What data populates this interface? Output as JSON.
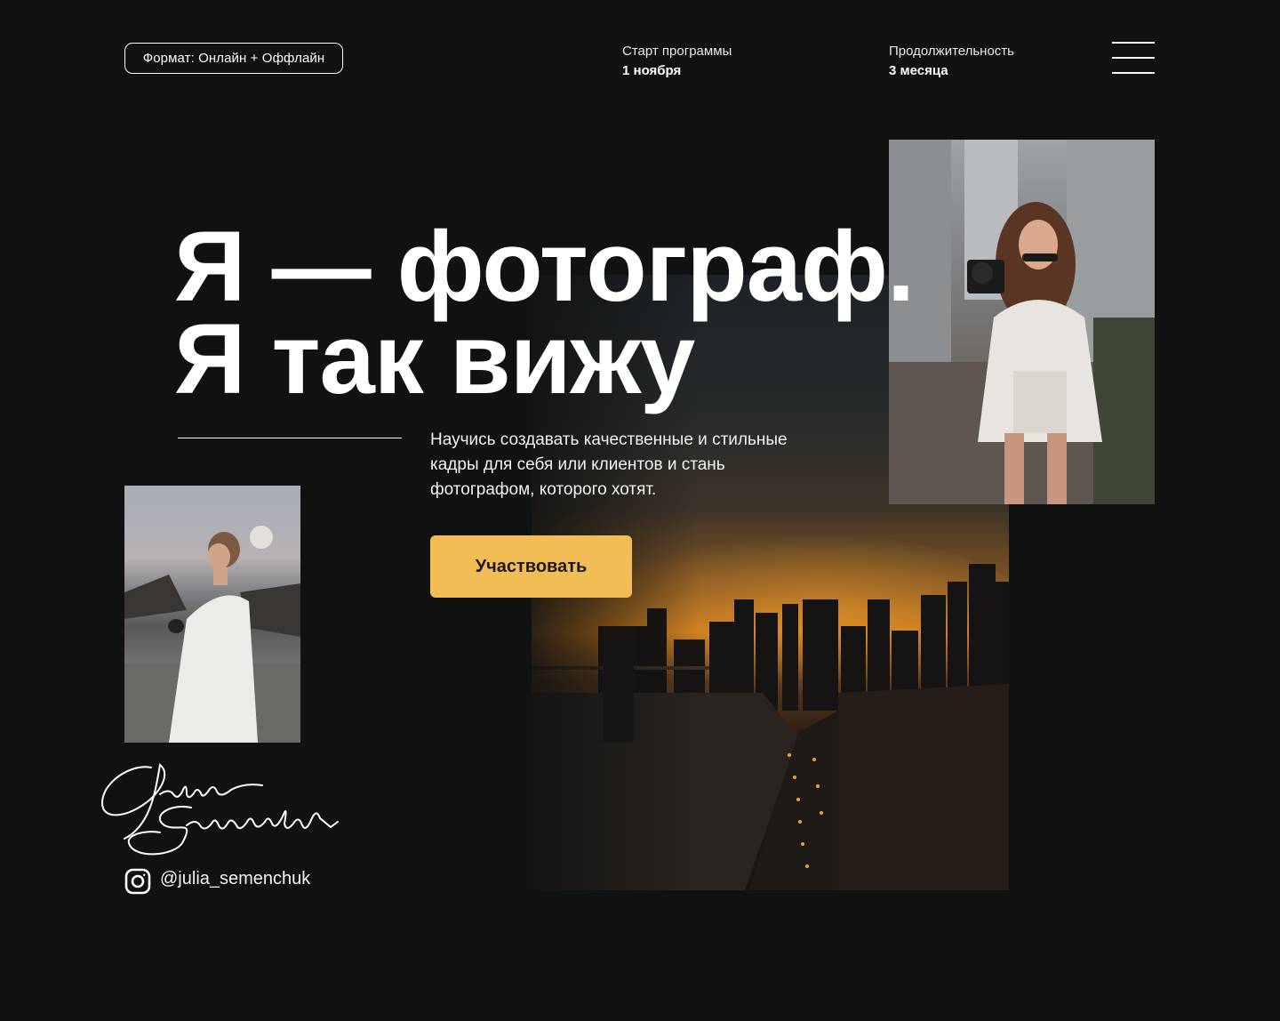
{
  "header": {
    "format_label": "Формат: Онлайн + Оффлайн",
    "start": {
      "label": "Старт программы",
      "value": "1 ноября"
    },
    "duration": {
      "label": "Продолжительность",
      "value": "3 месяца"
    }
  },
  "hero": {
    "title_line1": "Я — фотограф.",
    "title_line2": "Я так вижу",
    "description": "Научись создавать качественные и стильные кадры для себя или клиентов и стань фотографом, которого хотят.",
    "cta_label": "Участвовать"
  },
  "signature_text": "Julia Semenchuk",
  "social": {
    "icon": "instagram-icon",
    "handle": "@julia_semenchuk"
  },
  "colors": {
    "background": "#101111",
    "accent": "#f3bd55",
    "text": "#ffffff"
  }
}
